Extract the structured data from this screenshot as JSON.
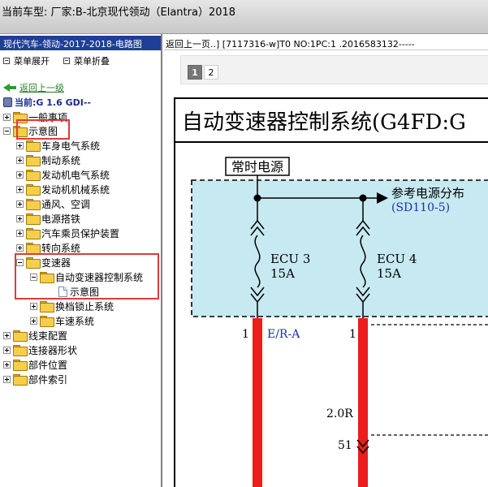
{
  "window": {
    "title": "当前车型:  厂家:B-北京现代领动（Elantra）2018"
  },
  "left_panel": {
    "header": "现代汽车-领动-2017-2018-电路图",
    "menu_expand": "菜单展开",
    "menu_collapse": "菜单折叠",
    "back_link": "返回上一级",
    "current": "当前:G 1.6 GDI--",
    "tree": [
      {
        "label": "一般事项",
        "level": 0,
        "expanded": false
      },
      {
        "label": "示意图",
        "level": 0,
        "expanded": true
      },
      {
        "label": "车身电气系统",
        "level": 1,
        "expanded": false
      },
      {
        "label": "制动系统",
        "level": 1,
        "expanded": false
      },
      {
        "label": "发动机电气系统",
        "level": 1,
        "expanded": false
      },
      {
        "label": "发动机机械系统",
        "level": 1,
        "expanded": false
      },
      {
        "label": "通风、空调",
        "level": 1,
        "expanded": false
      },
      {
        "label": "电源搭铁",
        "level": 1,
        "expanded": false
      },
      {
        "label": "汽车乘员保护装置",
        "level": 1,
        "expanded": false
      },
      {
        "label": "转向系统",
        "level": 1,
        "expanded": false
      },
      {
        "label": "变速器",
        "level": 1,
        "expanded": true
      },
      {
        "label": "自动变速器控制系统",
        "level": 2,
        "expanded": true
      },
      {
        "label": "示意图",
        "level": 3,
        "leaf": true
      },
      {
        "label": "换档锁止系统",
        "level": 2,
        "expanded": false
      },
      {
        "label": "车速系统",
        "level": 2,
        "expanded": false
      },
      {
        "label": "线束配置",
        "level": 0,
        "expanded": false
      },
      {
        "label": "连接器形状",
        "level": 0,
        "expanded": false
      },
      {
        "label": "部件位置",
        "level": 0,
        "expanded": false
      },
      {
        "label": "部件索引",
        "level": 0,
        "expanded": false
      }
    ]
  },
  "right_panel": {
    "header": "返回上一页..] [7117316-w]T0 NO:1PC:1 .2016583132-----",
    "pages": [
      "1",
      "2"
    ],
    "active_page": "1",
    "diagram": {
      "title": "自动变速器控制系统(G4FD:G",
      "power_label": "常时电源",
      "ref_label": "参考电源分布",
      "ref_code": "(SD110-5)",
      "fuse1_name": "ECU 3",
      "fuse1_rating": "15A",
      "fuse2_name": "ECU 4",
      "fuse2_rating": "15A",
      "wire1_pin": "1",
      "wire1_color": "E/R-A",
      "wire2_pin": "1",
      "wire_label": "2.0R",
      "connector_pin": "51"
    }
  },
  "colors": {
    "tree_header_bg": "#1f3e96",
    "highlight_box": "#e03a3a",
    "fuse_box_fill": "#c7e9f1",
    "wire_red": "#ee1c1c",
    "ref_blue": "#1f2fa8"
  }
}
